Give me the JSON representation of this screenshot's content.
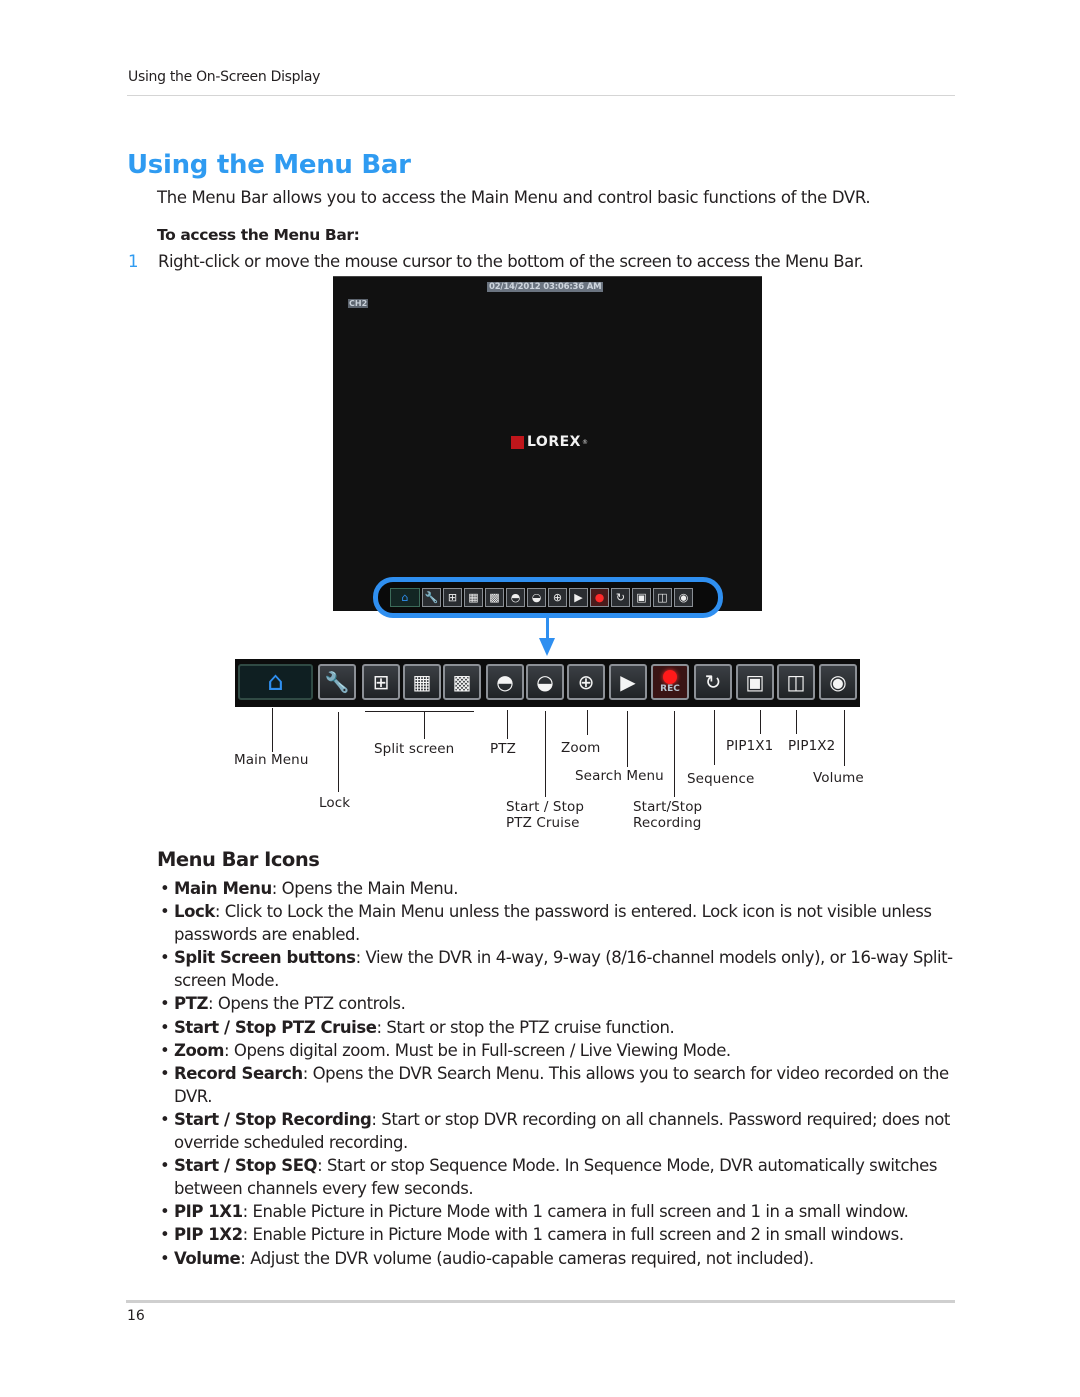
{
  "header": {
    "running_title": "Using the On-Screen Display"
  },
  "title": "Using the Menu Bar",
  "intro": "The Menu Bar allows you to access the Main Menu and control basic functions of the DVR.",
  "procedure": {
    "heading": "To access the Menu Bar:",
    "steps": [
      {
        "number": "1",
        "text": "Right-click or move the mouse cursor to the bottom of the screen to access the Menu Bar."
      }
    ]
  },
  "dvr_screenshot": {
    "timestamp": "02/14/2012 03:06:36 AM",
    "channel": "CH2",
    "logo": "LOREX",
    "logo_mark": "®",
    "accent_color": "#2f8ff0"
  },
  "menu_bar": {
    "icons": [
      {
        "name": "home",
        "glyph": "⌂"
      },
      {
        "name": "lock",
        "glyph": "🔧"
      },
      {
        "name": "split-4",
        "glyph": "⊞"
      },
      {
        "name": "split-9",
        "glyph": "▦"
      },
      {
        "name": "split-16",
        "glyph": "▩"
      },
      {
        "name": "ptz",
        "glyph": "◓"
      },
      {
        "name": "ptz-cruise",
        "glyph": "◒"
      },
      {
        "name": "zoom",
        "glyph": "⊕"
      },
      {
        "name": "search",
        "glyph": "▶"
      },
      {
        "name": "record",
        "glyph": "●",
        "label": "REC"
      },
      {
        "name": "sequence",
        "glyph": "↻"
      },
      {
        "name": "pip1x1",
        "glyph": "▣"
      },
      {
        "name": "pip1x2",
        "glyph": "◫"
      },
      {
        "name": "volume",
        "glyph": "◉"
      }
    ],
    "callouts": {
      "main_menu": "Main Menu",
      "lock": "Lock",
      "split_screen": "Split screen",
      "ptz": "PTZ",
      "ptz_cruise_line1": "Start / Stop",
      "ptz_cruise_line2": "PTZ Cruise",
      "zoom": "Zoom",
      "search_menu": "Search Menu",
      "recording_line1": "Start/Stop",
      "recording_line2": "Recording",
      "sequence": "Sequence",
      "pip1x1": "PIP1X1",
      "pip1x2": "PIP1X2",
      "volume": "Volume"
    }
  },
  "icons_section": {
    "heading": "Menu Bar Icons",
    "items": [
      {
        "term": "Main Menu",
        "desc": ": Opens the Main Menu."
      },
      {
        "term": "Lock",
        "desc": ": Click to Lock the Main Menu unless the password is entered. Lock icon is not visible unless passwords are enabled."
      },
      {
        "term": "Split Screen buttons",
        "desc": ": View the DVR in 4-way, 9-way (8/16-channel models only), or 16-way Split-screen Mode."
      },
      {
        "term": "PTZ",
        "desc": ": Opens the PTZ controls."
      },
      {
        "term": "Start / Stop PTZ Cruise",
        "desc": ": Start or stop the PTZ cruise function."
      },
      {
        "term": "Zoom",
        "desc": ": Opens digital zoom. Must be in Full-screen / Live Viewing Mode."
      },
      {
        "term": "Record Search",
        "desc": ": Opens the DVR Search Menu. This allows you to search for video recorded on the DVR."
      },
      {
        "term": "Start / Stop Recording",
        "desc": ": Start or stop DVR recording on all channels. Password required; does not override scheduled recording."
      },
      {
        "term": "Start / Stop SEQ",
        "desc": ": Start or stop Sequence Mode. In Sequence Mode, DVR automatically switches between channels every few seconds."
      },
      {
        "term": "PIP 1X1",
        "desc": ": Enable Picture in Picture Mode with 1 camera in full screen and 1 in a small window."
      },
      {
        "term": "PIP 1X2",
        "desc": ": Enable Picture in Picture Mode with 1 camera in full screen and 2 in small windows."
      },
      {
        "term": "Volume",
        "desc": ": Adjust the DVR volume (audio-capable cameras required, not included)."
      }
    ]
  },
  "footer": {
    "page_number": "16"
  },
  "colors": {
    "heading_blue": "#2f9bf1",
    "text": "#231f20"
  }
}
